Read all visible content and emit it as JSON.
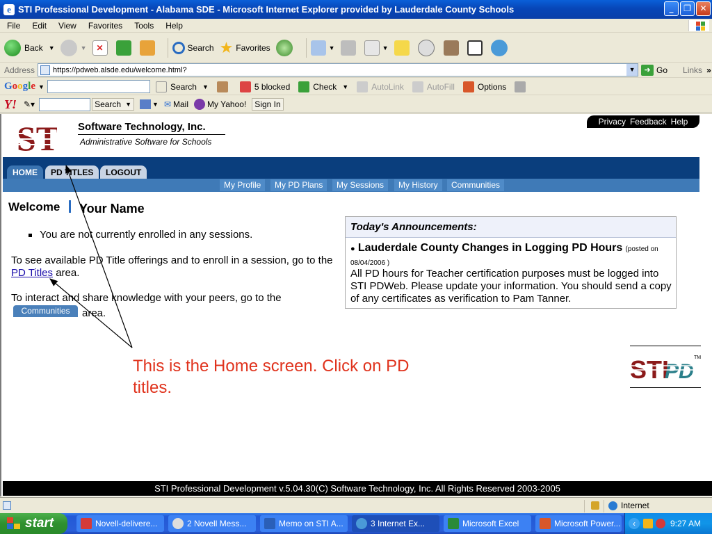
{
  "window": {
    "title": "STI Professional Development - Alabama SDE - Microsoft Internet Explorer provided by Lauderdale County Schools"
  },
  "menu": [
    "File",
    "Edit",
    "View",
    "Favorites",
    "Tools",
    "Help"
  ],
  "toolbar": {
    "back": "Back",
    "search": "Search",
    "favorites": "Favorites"
  },
  "address": {
    "label": "Address",
    "url": "https://pdweb.alsde.edu/welcome.html?",
    "go": "Go",
    "links": "Links"
  },
  "google_bar": {
    "logo": "Google",
    "search": "Search",
    "blocked": "5 blocked",
    "check": "Check",
    "autolink": "AutoLink",
    "autofill": "AutoFill",
    "options": "Options"
  },
  "yahoo_bar": {
    "logo": "Y!",
    "search": "Search",
    "mail": "Mail",
    "my_yahoo": "My Yahoo!",
    "sign_in": "Sign In"
  },
  "site": {
    "logo_text": "STI",
    "company_name": "Software Technology, Inc.",
    "tagline": "Administrative Software for Schools",
    "top_links": [
      "Privacy",
      "Feedback",
      "Help"
    ],
    "tabs": [
      "HOME",
      "PD TITLES",
      "LOGOUT"
    ],
    "subnav": [
      "My Profile",
      "My PD Plans",
      "My Sessions",
      "My History",
      "Communities"
    ],
    "welcome": "Welcome",
    "user_name": "Your Name",
    "not_enrolled": "You are not currently enrolled in any sessions.",
    "pd_text_before": "To see available PD Title offerings and to enroll in a session, go to the",
    "pd_link": "PD Titles",
    "pd_text_after": "area.",
    "community_text": "To interact and share knowledge with your peers, go to the",
    "community_button": "Communities",
    "community_after": "area.",
    "announcements": {
      "heading": "Today's Announcements:",
      "title": "Lauderdale County Changes in Logging PD Hours",
      "posted": "(posted on 08/04/2006 )",
      "body": "All PD hours for Teacher certification purposes must be logged into STI PDWeb. Please update your information. You should send a copy of any certificates as verification to Pam Tanner."
    },
    "callout": "This is the Home screen.  Click on PD titles.",
    "stipd_logo": "STIPD",
    "footer": "STI Professional Development v.5.04.30(C) Software Technology, Inc. All Rights Reserved 2003-2005"
  },
  "status": {
    "zone": "Internet"
  },
  "taskbar": {
    "start": "start",
    "tasks": [
      "Novell-delivere...",
      "2 Novell Mess...",
      "Memo on STI A...",
      "3 Internet Ex...",
      "Microsoft Excel",
      "Microsoft Power..."
    ],
    "clock": "9:27 AM"
  },
  "colors": {
    "nav_dark": "#0a3e7d",
    "callout_red": "#e0321c",
    "sti_red": "#8b1a1a"
  }
}
